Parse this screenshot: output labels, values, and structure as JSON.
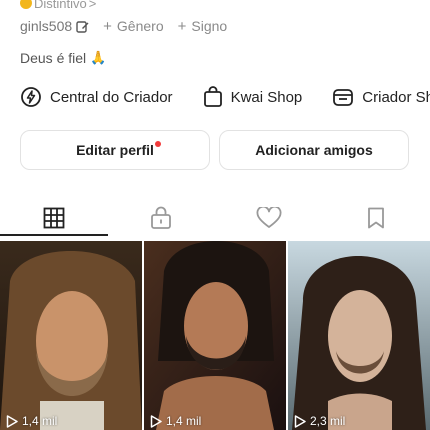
{
  "header": {
    "badge_label": "Distintivo",
    "badge_chevron": ">",
    "user_id": "ginls508",
    "gender_label": "Gênero",
    "sign_label": "Signo",
    "plus_glyph": "+"
  },
  "bio": {
    "text": "Deus é fiel",
    "emoji": "🙏"
  },
  "links": [
    {
      "label": "Central do Criador",
      "icon": "lightning-circle-icon"
    },
    {
      "label": "Kwai Shop",
      "icon": "shopping-bag-icon"
    },
    {
      "label": "Criador Sho",
      "icon": "store-icon"
    }
  ],
  "actions": {
    "edit_profile": "Editar perfil",
    "add_friends": "Adicionar amigos"
  },
  "tabs": [
    {
      "name": "grid",
      "icon": "grid-icon",
      "active": true
    },
    {
      "name": "private",
      "icon": "lock-icon",
      "active": false
    },
    {
      "name": "liked",
      "icon": "heart-icon",
      "active": false
    },
    {
      "name": "saved",
      "icon": "bookmark-icon",
      "active": false
    }
  ],
  "videos": [
    {
      "views": "1,4 mil"
    },
    {
      "views": "1,4 mil"
    },
    {
      "views": "2,3 mil"
    }
  ],
  "colors": {
    "badge": "#f2b61c",
    "notification_dot": "#f23b3b",
    "text_primary": "#222222",
    "text_secondary": "#8a8a8a"
  }
}
